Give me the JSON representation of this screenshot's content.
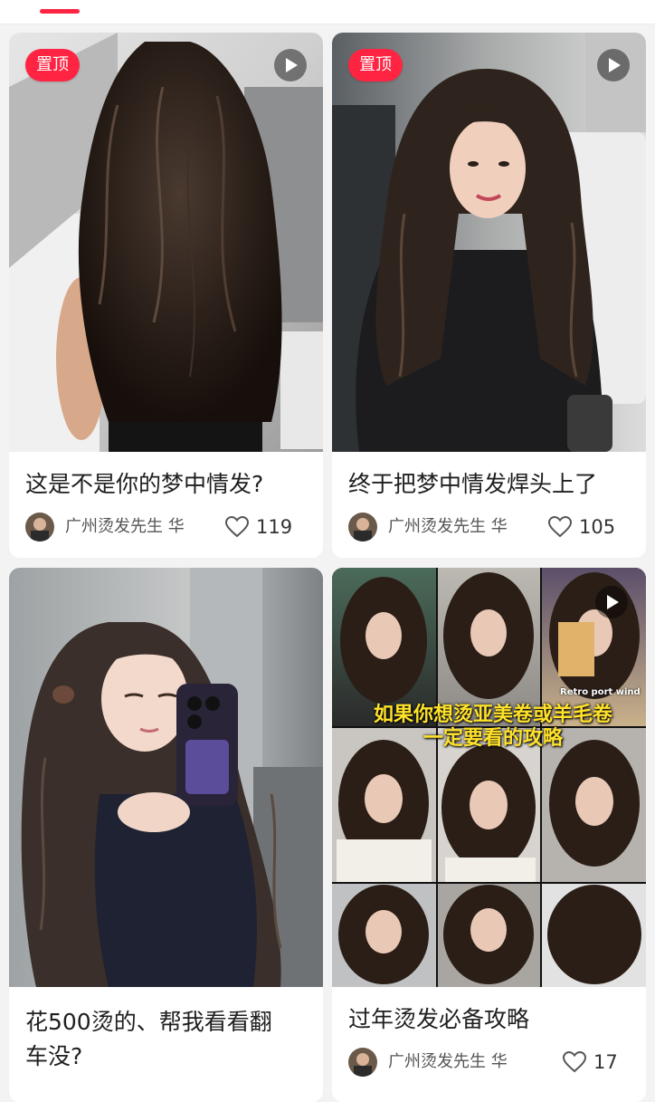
{
  "colors": {
    "accent": "#ff2442",
    "background": "#f3f3f3",
    "card": "#ffffff",
    "title_text": "#1f1f1f",
    "meta_text": "#555555"
  },
  "feed": {
    "posts": [
      {
        "pin_label": "置顶",
        "has_video": true,
        "title": "这是不是你的梦中情发?",
        "author": "广州烫发先生 华",
        "likes": "119"
      },
      {
        "pin_label": "置顶",
        "has_video": true,
        "title": "终于把梦中情发焊头上了",
        "author": "广州烫发先生 华",
        "likes": "105"
      },
      {
        "title_line1": "花500烫的、帮我看看翻",
        "title_line2": "车没?"
      },
      {
        "has_video": true,
        "overlay_line1": "如果你想烫亚美卷或羊毛卷",
        "overlay_line2": "一定要看的攻略",
        "overlay_small": "Retro port wind",
        "title": "过年烫发必备攻略",
        "author": "广州烫发先生 华",
        "likes": "17"
      }
    ]
  }
}
